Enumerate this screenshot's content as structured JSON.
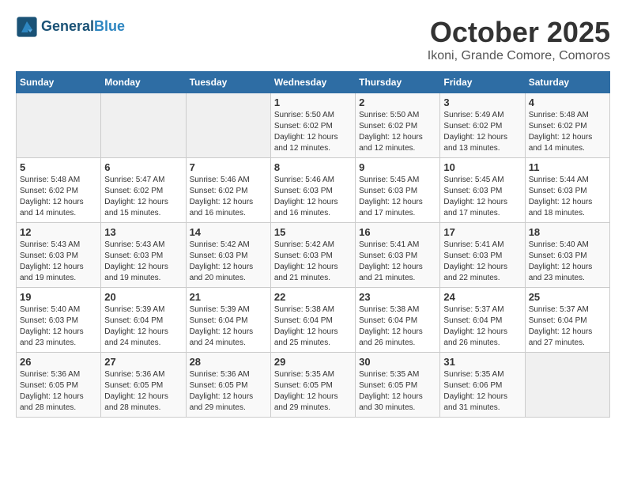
{
  "header": {
    "logo_line1": "General",
    "logo_line2": "Blue",
    "month": "October 2025",
    "location": "Ikoni, Grande Comore, Comoros"
  },
  "days_of_week": [
    "Sunday",
    "Monday",
    "Tuesday",
    "Wednesday",
    "Thursday",
    "Friday",
    "Saturday"
  ],
  "weeks": [
    [
      {
        "day": "",
        "info": ""
      },
      {
        "day": "",
        "info": ""
      },
      {
        "day": "",
        "info": ""
      },
      {
        "day": "1",
        "info": "Sunrise: 5:50 AM\nSunset: 6:02 PM\nDaylight: 12 hours\nand 12 minutes."
      },
      {
        "day": "2",
        "info": "Sunrise: 5:50 AM\nSunset: 6:02 PM\nDaylight: 12 hours\nand 12 minutes."
      },
      {
        "day": "3",
        "info": "Sunrise: 5:49 AM\nSunset: 6:02 PM\nDaylight: 12 hours\nand 13 minutes."
      },
      {
        "day": "4",
        "info": "Sunrise: 5:48 AM\nSunset: 6:02 PM\nDaylight: 12 hours\nand 14 minutes."
      }
    ],
    [
      {
        "day": "5",
        "info": "Sunrise: 5:48 AM\nSunset: 6:02 PM\nDaylight: 12 hours\nand 14 minutes."
      },
      {
        "day": "6",
        "info": "Sunrise: 5:47 AM\nSunset: 6:02 PM\nDaylight: 12 hours\nand 15 minutes."
      },
      {
        "day": "7",
        "info": "Sunrise: 5:46 AM\nSunset: 6:02 PM\nDaylight: 12 hours\nand 16 minutes."
      },
      {
        "day": "8",
        "info": "Sunrise: 5:46 AM\nSunset: 6:03 PM\nDaylight: 12 hours\nand 16 minutes."
      },
      {
        "day": "9",
        "info": "Sunrise: 5:45 AM\nSunset: 6:03 PM\nDaylight: 12 hours\nand 17 minutes."
      },
      {
        "day": "10",
        "info": "Sunrise: 5:45 AM\nSunset: 6:03 PM\nDaylight: 12 hours\nand 17 minutes."
      },
      {
        "day": "11",
        "info": "Sunrise: 5:44 AM\nSunset: 6:03 PM\nDaylight: 12 hours\nand 18 minutes."
      }
    ],
    [
      {
        "day": "12",
        "info": "Sunrise: 5:43 AM\nSunset: 6:03 PM\nDaylight: 12 hours\nand 19 minutes."
      },
      {
        "day": "13",
        "info": "Sunrise: 5:43 AM\nSunset: 6:03 PM\nDaylight: 12 hours\nand 19 minutes."
      },
      {
        "day": "14",
        "info": "Sunrise: 5:42 AM\nSunset: 6:03 PM\nDaylight: 12 hours\nand 20 minutes."
      },
      {
        "day": "15",
        "info": "Sunrise: 5:42 AM\nSunset: 6:03 PM\nDaylight: 12 hours\nand 21 minutes."
      },
      {
        "day": "16",
        "info": "Sunrise: 5:41 AM\nSunset: 6:03 PM\nDaylight: 12 hours\nand 21 minutes."
      },
      {
        "day": "17",
        "info": "Sunrise: 5:41 AM\nSunset: 6:03 PM\nDaylight: 12 hours\nand 22 minutes."
      },
      {
        "day": "18",
        "info": "Sunrise: 5:40 AM\nSunset: 6:03 PM\nDaylight: 12 hours\nand 23 minutes."
      }
    ],
    [
      {
        "day": "19",
        "info": "Sunrise: 5:40 AM\nSunset: 6:03 PM\nDaylight: 12 hours\nand 23 minutes."
      },
      {
        "day": "20",
        "info": "Sunrise: 5:39 AM\nSunset: 6:04 PM\nDaylight: 12 hours\nand 24 minutes."
      },
      {
        "day": "21",
        "info": "Sunrise: 5:39 AM\nSunset: 6:04 PM\nDaylight: 12 hours\nand 24 minutes."
      },
      {
        "day": "22",
        "info": "Sunrise: 5:38 AM\nSunset: 6:04 PM\nDaylight: 12 hours\nand 25 minutes."
      },
      {
        "day": "23",
        "info": "Sunrise: 5:38 AM\nSunset: 6:04 PM\nDaylight: 12 hours\nand 26 minutes."
      },
      {
        "day": "24",
        "info": "Sunrise: 5:37 AM\nSunset: 6:04 PM\nDaylight: 12 hours\nand 26 minutes."
      },
      {
        "day": "25",
        "info": "Sunrise: 5:37 AM\nSunset: 6:04 PM\nDaylight: 12 hours\nand 27 minutes."
      }
    ],
    [
      {
        "day": "26",
        "info": "Sunrise: 5:36 AM\nSunset: 6:05 PM\nDaylight: 12 hours\nand 28 minutes."
      },
      {
        "day": "27",
        "info": "Sunrise: 5:36 AM\nSunset: 6:05 PM\nDaylight: 12 hours\nand 28 minutes."
      },
      {
        "day": "28",
        "info": "Sunrise: 5:36 AM\nSunset: 6:05 PM\nDaylight: 12 hours\nand 29 minutes."
      },
      {
        "day": "29",
        "info": "Sunrise: 5:35 AM\nSunset: 6:05 PM\nDaylight: 12 hours\nand 29 minutes."
      },
      {
        "day": "30",
        "info": "Sunrise: 5:35 AM\nSunset: 6:05 PM\nDaylight: 12 hours\nand 30 minutes."
      },
      {
        "day": "31",
        "info": "Sunrise: 5:35 AM\nSunset: 6:06 PM\nDaylight: 12 hours\nand 31 minutes."
      },
      {
        "day": "",
        "info": ""
      }
    ]
  ]
}
